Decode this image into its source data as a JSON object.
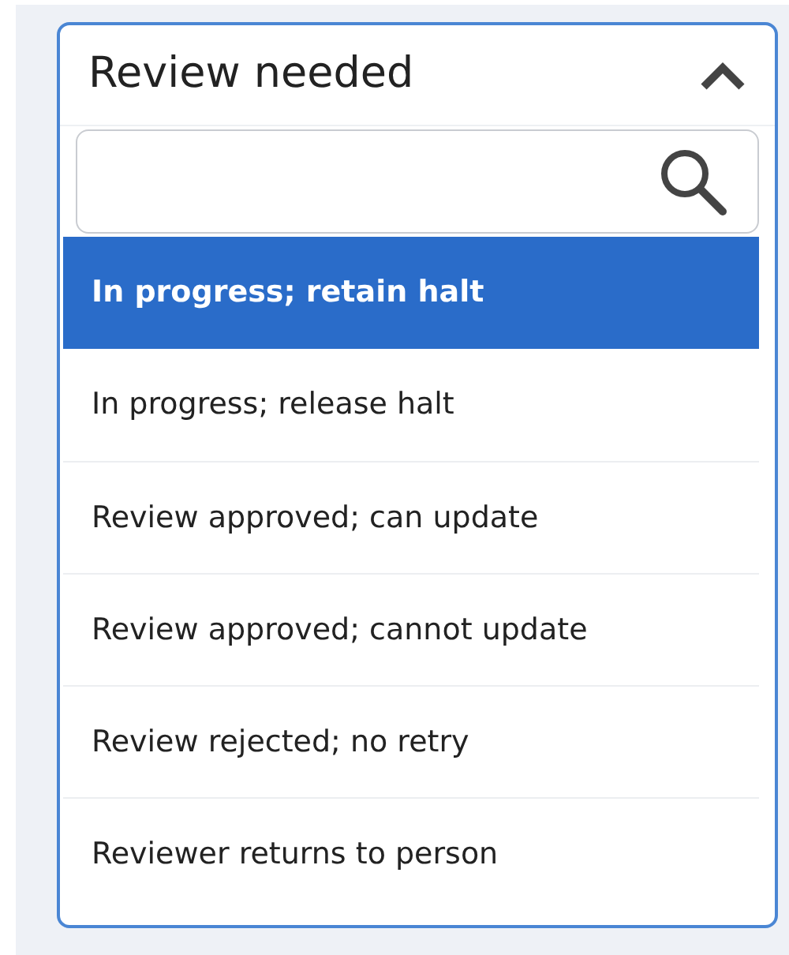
{
  "dropdown": {
    "value": "Review needed",
    "expanded": true,
    "options": [
      {
        "label": "In progress; retain halt",
        "selected": true
      },
      {
        "label": "In progress; release halt",
        "selected": false
      },
      {
        "label": "Review approved; can update",
        "selected": false
      },
      {
        "label": "Review approved; cannot update",
        "selected": false
      },
      {
        "label": "Review rejected; no retry",
        "selected": false
      },
      {
        "label": "Reviewer returns to person",
        "selected": false
      }
    ]
  }
}
